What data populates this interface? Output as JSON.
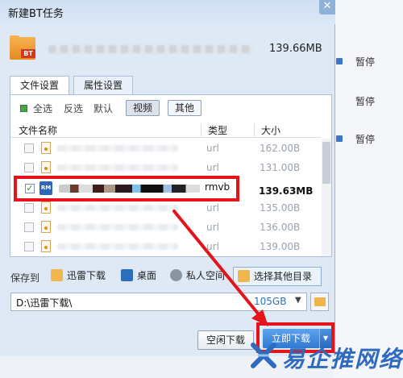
{
  "dialog": {
    "title": "新建BT任务",
    "close_glyph": "✕",
    "file_tag": "BT",
    "total_size": "139.66MB"
  },
  "tabs": [
    {
      "label": "文件设置",
      "active": true
    },
    {
      "label": "属性设置",
      "active": false
    }
  ],
  "filter": {
    "select_all": "全选",
    "invert": "反选",
    "default": "默认",
    "video": "视频",
    "other": "其他"
  },
  "columns": {
    "name": "文件名称",
    "type": "类型",
    "size": "大小"
  },
  "files": [
    {
      "type": "url",
      "size": "162.00B",
      "checked": false
    },
    {
      "type": "url",
      "size": "131.00B",
      "checked": false
    },
    {
      "type": "rmvb",
      "size": "139.63MB",
      "checked": true,
      "icon_text": "RM"
    },
    {
      "type": "url",
      "size": "135.00B",
      "checked": false
    },
    {
      "type": "url",
      "size": "136.00B",
      "checked": false
    },
    {
      "type": "url",
      "size": "139.00B",
      "checked": false
    }
  ],
  "save": {
    "label": "保存到",
    "options": [
      "迅雷下载",
      "桌面",
      "私人空间",
      "选择其他目录"
    ],
    "path": "D:\\迅雷下载\\",
    "free_space": "105GB",
    "dropdown_glyph": "▼"
  },
  "buttons": {
    "idle_download": "空闲下载",
    "start_download": "立即下载",
    "start_dropdown_glyph": "▼"
  },
  "background_app": {
    "pause_label": "暂停"
  },
  "watermark": "易企推网络",
  "colors": {
    "highlight": "#e4141b",
    "accent_blue": "#2f79d1",
    "muted_text": "#9aa3ae"
  }
}
